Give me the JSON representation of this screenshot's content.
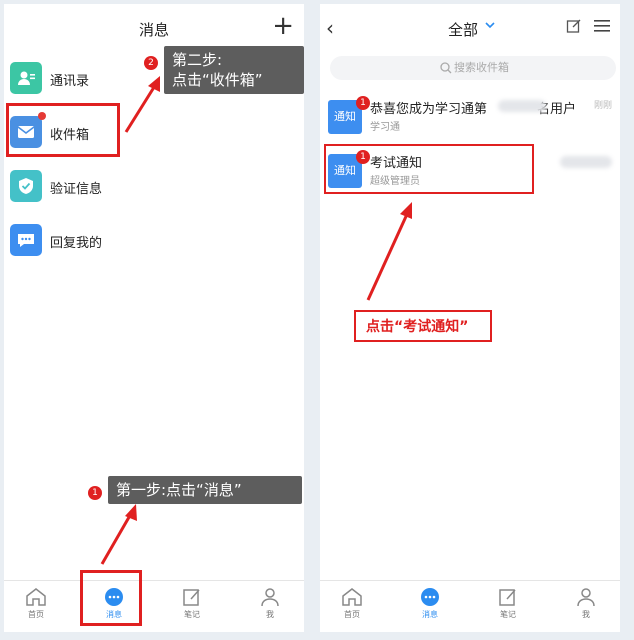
{
  "left_screen": {
    "title": "消息",
    "menu": [
      {
        "label": "通讯录",
        "icon": "contacts-icon",
        "color": "#3cc6a4"
      },
      {
        "label": "收件箱",
        "icon": "inbox-icon",
        "color": "#4a90e2"
      },
      {
        "label": "验证信息",
        "icon": "verify-shield-icon",
        "color": "#44c1c8"
      },
      {
        "label": "回复我的",
        "icon": "reply-chat-icon",
        "color": "#3d8ef0"
      }
    ],
    "step2_badge": "2",
    "step2_text": "第二步:",
    "step2_text2": "点击“收件箱”",
    "step1_badge": "1",
    "step1_text": "第一步:点击“消息”"
  },
  "right_screen": {
    "title": "全部",
    "search_placeholder": "搜索收件箱",
    "messages": [
      {
        "icon_text": "通知",
        "badge": "1",
        "title": "恭喜您成为学习通第",
        "title_suffix": "名用户",
        "sub": "学习通",
        "time": "刚刚"
      },
      {
        "icon_text": "通知",
        "badge": "1",
        "title": "考试通知",
        "sub": "超级管理员"
      }
    ],
    "annotation": "点击“考试通知”"
  },
  "tabs": [
    {
      "label": "首页",
      "icon": "home-icon"
    },
    {
      "label": "消息",
      "icon": "message-icon"
    },
    {
      "label": "笔记",
      "icon": "note-icon"
    },
    {
      "label": "我",
      "icon": "profile-icon"
    }
  ],
  "colors": {
    "accent": "#2b8cf0",
    "annotation_red": "#e02020"
  }
}
